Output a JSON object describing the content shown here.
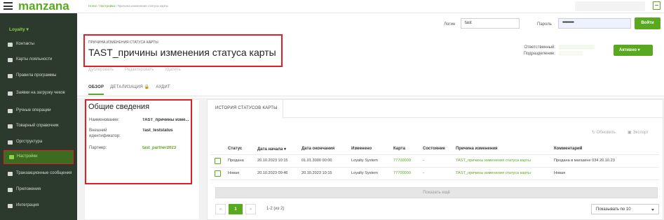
{
  "topbar": {
    "logo": "manzana",
    "breadcrumbs": [
      "Home",
      "Настройки",
      "Причина изменения статуса карты"
    ],
    "breadcrumb_sep": " / "
  },
  "sidebar": {
    "section": "Loyalty ▾",
    "items": [
      {
        "label": "Контакты"
      },
      {
        "label": "Карты лояльности"
      },
      {
        "label": "Правила программы"
      },
      {
        "label": "Заявки на загрузку чеков"
      },
      {
        "label": "Ручные операции"
      },
      {
        "label": "Товарный справочник"
      },
      {
        "label": "Оргструктура"
      },
      {
        "label": "Настройки"
      },
      {
        "label": "Транзакционные сообщения"
      },
      {
        "label": "Приложения"
      },
      {
        "label": "Интеграция"
      }
    ]
  },
  "auth": {
    "login_label": "Логин",
    "login_value": "tast",
    "password_label": "Пароль",
    "password_value": "•••••••••••",
    "login_button": "Войти"
  },
  "header": {
    "subtitle": "ПРИЧИНА ИЗМЕНЕНИЯ СТАТУСА КАРТЫ",
    "title": "TAST_причины изменения статуса карты",
    "responsible_label": "Ответственный:",
    "department_label": "Подразделение:",
    "status_button": "Активно ▾",
    "actions": [
      "Дублировать",
      "Редактировать",
      "Удалить"
    ]
  },
  "tabs": [
    "ОБЗОР",
    "ДЕТАЛИЗАЦИЯ 🔒",
    "АУДИТ"
  ],
  "general": {
    "title": "Общие сведения",
    "fields": [
      {
        "label": "Наименование:",
        "value": "TAST_причины изме..."
      },
      {
        "label": "Внешний идентификатор:",
        "value": "Tast_teststatus"
      },
      {
        "label": "Партнер:",
        "value": "tast_partner2023"
      }
    ]
  },
  "history": {
    "tab": "ИСТОРИЯ СТАТУСОВ КАРТЫ",
    "refresh": "Обновить",
    "export": "Экспорт",
    "columns": [
      "Статус",
      "Дата начала ▾",
      "Дата окончания",
      "Изменено",
      "Карта",
      "Состояние",
      "Причина изменения",
      "Комментарий"
    ],
    "rows": [
      [
        "Продана",
        "20.10.2023 10:15",
        "01.01.3000 00:00",
        "Loyalty System",
        "77700000",
        "-",
        "TAST_причины изменения статуса карты",
        "Продана в магазине 034 20.10.23"
      ],
      [
        "Новая",
        "20.10.2023 09:46",
        "20.10.2023 10:15",
        "Loyalty System",
        "77700000",
        "-",
        "TAST_причины изменения статуса карты",
        "Новая"
      ]
    ],
    "show_more": "Показать ещё",
    "pager": {
      "prev": "«",
      "current": "1",
      "next": "»",
      "info": "1-2 (из 2)"
    },
    "per_page": "Показывать по 10"
  }
}
